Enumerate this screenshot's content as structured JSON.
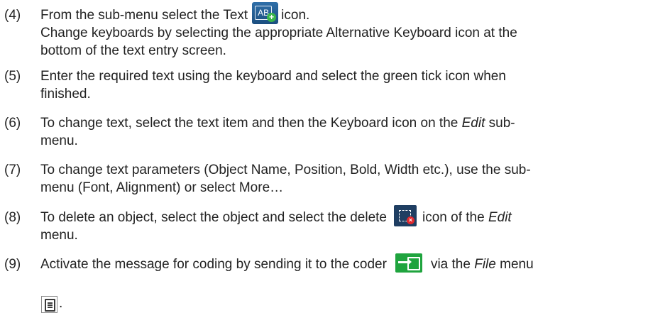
{
  "steps": [
    {
      "num": "(4)",
      "line1_before": "From the sub-menu select the Text",
      "line1_after": "icon.",
      "line2": "Change keyboards by selecting the appropriate Alternative Keyboard icon at the",
      "line3": "bottom of the text entry screen.",
      "icon": "text-ab-plus-icon"
    },
    {
      "num": "(5)",
      "line1": "Enter the required text using the keyboard and select the green tick icon when",
      "line2": "finished."
    },
    {
      "num": "(6)",
      "line1_before": "To change text, select the text item and then the Keyboard icon on the",
      "line1_em": "Edit",
      "line1_after": "sub-",
      "line2": "menu."
    },
    {
      "num": "(7)",
      "line1": "To change text parameters (Object Name, Position, Bold, Width etc.), use the sub-",
      "line2": "menu (Font, Alignment) or select More…"
    },
    {
      "num": "(8)",
      "line1_before": "To delete an object, select the object and select the delete",
      "line1_mid": "icon of the",
      "line1_em": "Edit",
      "line2": "menu.",
      "icon": "delete-object-icon"
    },
    {
      "num": "(9)",
      "line1_before": "Activate the message for coding by sending it to the coder",
      "line1_mid": "via the",
      "line1_em": "File",
      "line1_after": "menu",
      "line2_end": ".",
      "icons": [
        "send-to-coder-icon",
        "file-menu-icon"
      ]
    }
  ],
  "icon_labels": {
    "text_icon": "AB",
    "text_icon_plus": "+",
    "delete_icon_x": "×"
  },
  "colors": {
    "text_icon_bg": "#2f6fa8",
    "delete_icon_bg": "#1f3e62",
    "send_icon_bg": "#1fa43e",
    "accent_green": "#39b54a",
    "accent_red": "#e0282e"
  }
}
